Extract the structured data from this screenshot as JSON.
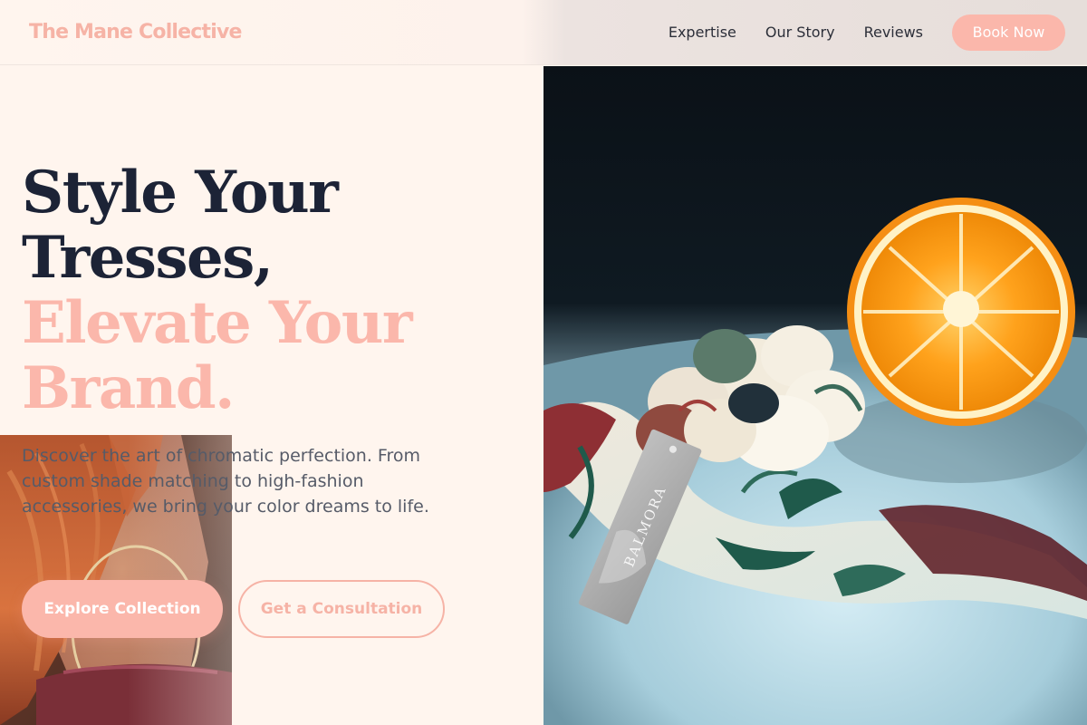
{
  "header": {
    "brand": "The Mane Collective",
    "nav": [
      "Expertise",
      "Our Story",
      "Reviews"
    ],
    "cta": "Book Now"
  },
  "hero": {
    "headline_dark": [
      "Style Your",
      "Tresses,"
    ],
    "headline_accent": [
      "Elevate Your",
      "Brand."
    ],
    "lead": "Discover the art of chromatic perfection. From custom shade matching to high-fashion accessories, we bring your color dreams to life.",
    "primary_cta": "Explore Collection",
    "secondary_cta": "Get a Consultation"
  },
  "product_image": {
    "tag_brand": "BALMORA"
  },
  "colors": {
    "accent": "#fbb7ab",
    "headline": "#1c2336",
    "background": "#fff5ee",
    "body_text": "#565b68"
  }
}
